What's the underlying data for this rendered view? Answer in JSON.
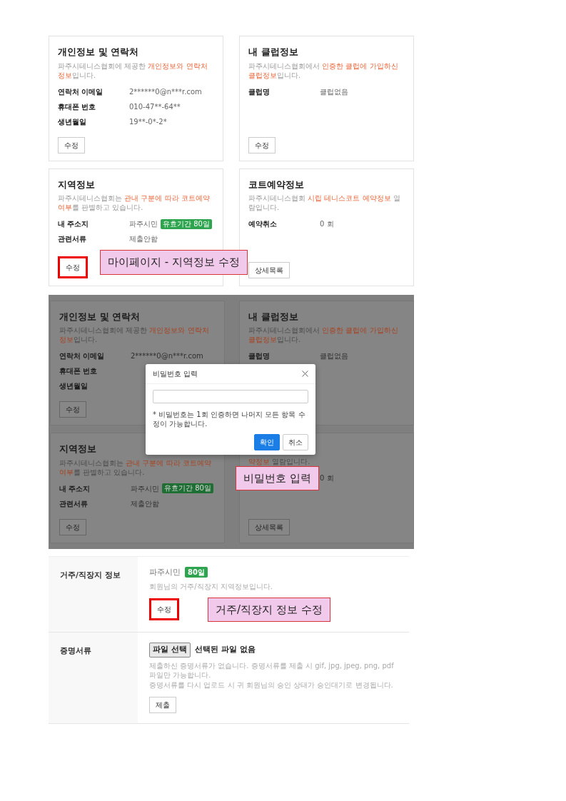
{
  "screen_mypage": {
    "cards": [
      {
        "title": "개인정보 및 연락처",
        "subtitle": "파주시테니스협회에 제공한 **개인정보와 연락처 정보**입니다.",
        "rows": [
          {
            "label": "연락처 이메일",
            "value": "2******0@n***r.com"
          },
          {
            "label": "휴대폰 번호",
            "value": "010-47**-64**"
          },
          {
            "label": "생년월일",
            "value": "19**-0*-2*"
          }
        ],
        "button": {
          "label": "수정",
          "highlighted": false
        }
      },
      {
        "title": "내 클럽정보",
        "subtitle": "파주시테니스협회에서 **인증한 클럽에 가입하신 클럽정보**입니다.",
        "rows": [
          {
            "label": "클럽명",
            "value": "클럽없음"
          }
        ],
        "button": {
          "label": "수정",
          "highlighted": false
        }
      },
      {
        "title": "지역정보",
        "subtitle": "파주시테니스협회는 **관내 구분에 따라 코트예약 여부**를 판별하고 있습니다.",
        "rows": [
          {
            "label": "내 주소지",
            "value": "파주시민",
            "badge": "유효기간 80일"
          },
          {
            "label": "관련서류",
            "value": "제출안함"
          }
        ],
        "button": {
          "label": "수정",
          "highlighted": true
        }
      },
      {
        "title": "코트예약정보",
        "subtitle": "파주시테니스협회 **시립 테니스코트 예약정보** 열람입니다.",
        "rows": [
          {
            "label": "예약취소",
            "value": "0 회"
          }
        ],
        "button": {
          "label": "상세목록",
          "highlighted": false
        }
      }
    ],
    "annotation": "마이페이지 - 지역정보 수정"
  },
  "screen_password": {
    "cards": [
      {
        "title": "개인정보 및 연락처",
        "subtitle": "파주시테니스협회에 제공한 **개인정보와 연락처 정보**입니다.",
        "rows": [
          {
            "label": "연락처 이메일",
            "value": "2******0@n***r.com"
          },
          {
            "label": "휴대폰 번호"
          },
          {
            "label": "생년월일"
          }
        ],
        "button": {
          "label": "수정",
          "highlighted": false
        }
      },
      {
        "title": "내 클럽정보",
        "subtitle": "파주시테니스협회에서 **인증한 클럽에 가입하신 클럽정보**입니다.",
        "rows": [
          {
            "label": "클럽명",
            "value": "클럽없음"
          }
        ]
      },
      {
        "title": "지역정보",
        "subtitle": "파주시테니스협회는 **관내 구분에 따라 코트예약 여부**를 판별하고 있습니다.",
        "rows": [
          {
            "label": "내 주소지",
            "value": "파주시민",
            "badge": "유효기간 80일"
          },
          {
            "label": "관련서류",
            "value": "제출안함"
          }
        ],
        "button": {
          "label": "수정",
          "highlighted": false
        }
      },
      {
        "subtitle": "**약정보** 열람입니다.",
        "rows": [
          {
            "value": "0 회"
          }
        ],
        "button": {
          "label": "상세목록",
          "highlighted": false
        }
      }
    ],
    "modal": {
      "title": "비밀번호 입력",
      "note": "* 비밀번호는 1회 인증하면 나머지 모든 항목 수정이 가능합니다.",
      "buttons": [
        {
          "label": "확인",
          "kind": "primary"
        },
        {
          "label": "취소",
          "kind": "secondary"
        }
      ]
    },
    "annotation": "비밀번호 입력"
  },
  "screen_residence": {
    "rows": [
      {
        "kind": "status",
        "label": "거주/직장지 정보",
        "status": "파주시민",
        "badge": "80일",
        "notes": [
          "회원님의 거주/직장지 지역정보입니다."
        ],
        "button": {
          "label": "수정",
          "highlighted": true
        },
        "annotation": "거주/직장지 정보 수정"
      },
      {
        "kind": "file",
        "label": "증명서류",
        "file_button": "파일 선택",
        "file_status": "선택된 파일 없음",
        "notes": [
          "제출하신 증명서류가 없습니다. 증명서류를 제출 시 gif, jpg, jpeg, png, pdf 파일만 가능합니다.",
          "증명서류를 다시 업로드 시 귀 회원님의 승인 상태가 승인대기로 변경됩니다."
        ],
        "button": {
          "label": "제출",
          "highlighted": false
        }
      }
    ]
  }
}
